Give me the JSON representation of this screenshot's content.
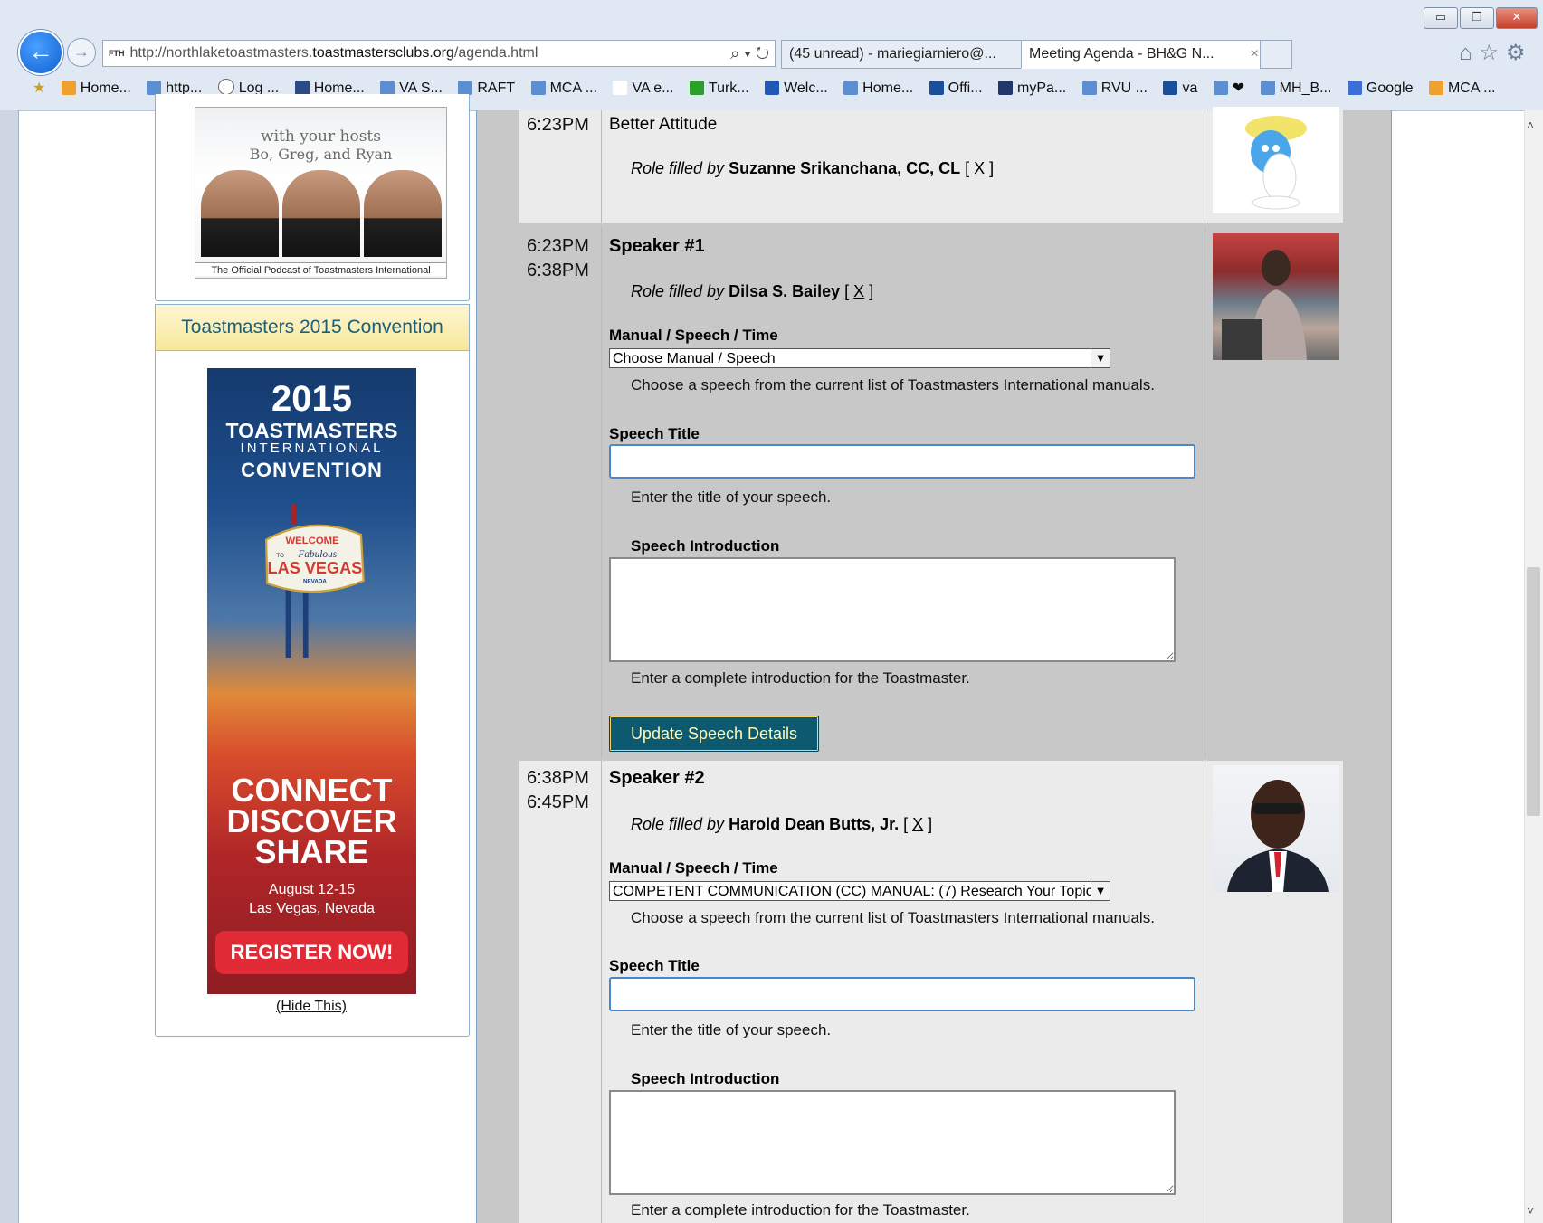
{
  "browser": {
    "url_prefix": "http://northlaketoastmasters.",
    "url_domain": "toastmastersclubs.org",
    "url_path": "/agenda.html",
    "url_favicon": "FTH",
    "addr_tools": "⌕ ▾ ↻",
    "tabs": [
      {
        "label": "(45 unread) - mariegiarniero@..."
      },
      {
        "label": "Meeting Agenda - BH&G N...",
        "close": "×"
      }
    ],
    "window_controls": [
      "▭",
      "❐",
      "✕"
    ],
    "tool_icons": "⌂☆⚙",
    "favorites": [
      "Home...",
      "http...",
      "Log ...",
      "Home...",
      "VA S...",
      "RAFT",
      "MCA ...",
      "VA e...",
      "Turk...",
      "Welc...",
      "Home...",
      "Offi...",
      "myPa...",
      "RVU ...",
      "va",
      "❤",
      "MH_B...",
      "Google",
      "MCA ..."
    ]
  },
  "sidebar": {
    "podcast": {
      "hosts_line1": "with your hosts",
      "hosts_line2": "Bo, Greg, and Ryan",
      "caption": "The Official Podcast of Toastmasters International"
    },
    "convention": {
      "heading": "Toastmasters 2015 Convention",
      "year": "2015",
      "toastmasters": "TOASTMASTERS",
      "international": "INTERNATIONAL",
      "convention": "CONVENTION",
      "sign_welcome": "WELCOME",
      "sign_to": "TO",
      "sign_fabulous": "Fabulous",
      "sign_city": "LAS VEGAS",
      "sign_state": "NEVADA",
      "connect": "CONNECT",
      "discover": "DISCOVER",
      "share": "SHARE",
      "dates": "August 12-15",
      "location": "Las Vegas, Nevada",
      "register": "REGISTER NOW!"
    },
    "hide_link": "(Hide This)"
  },
  "agenda": {
    "role_filled_by": "Role filled by",
    "remove": "X",
    "rows": [
      {
        "start": "6:23PM",
        "title": "Better Attitude",
        "filled_by": "Suzanne Srikanchana, CC, CL"
      },
      {
        "start": "6:23PM",
        "end": "6:38PM",
        "title": "Speaker #1",
        "filled_by": "Dilsa S. Bailey",
        "manual_label": "Manual / Speech / Time",
        "manual_value": "Choose Manual / Speech",
        "manual_help": "Choose a speech from the current list of Toastmasters International manuals.",
        "title_label": "Speech Title",
        "title_value": "",
        "title_help": "Enter the title of your speech.",
        "intro_label": "Speech Introduction",
        "intro_value": "",
        "intro_help": "Enter a complete introduction for the Toastmaster.",
        "update_button": "Update Speech Details"
      },
      {
        "start": "6:38PM",
        "end": "6:45PM",
        "title": "Speaker #2",
        "filled_by": "Harold Dean Butts, Jr.",
        "manual_label": "Manual / Speech / Time",
        "manual_value": "COMPETENT COMMUNICATION (CC) MANUAL: (7) Research Your Topic",
        "manual_help": "Choose a speech from the current list of Toastmasters International manuals.",
        "title_label": "Speech Title",
        "title_value": "",
        "title_help": "Enter the title of your speech.",
        "intro_label": "Speech Introduction",
        "intro_value": "",
        "intro_help": "Enter a complete introduction for the Toastmaster."
      }
    ]
  },
  "scrollbar": {
    "up": "˄",
    "down": "˅"
  }
}
